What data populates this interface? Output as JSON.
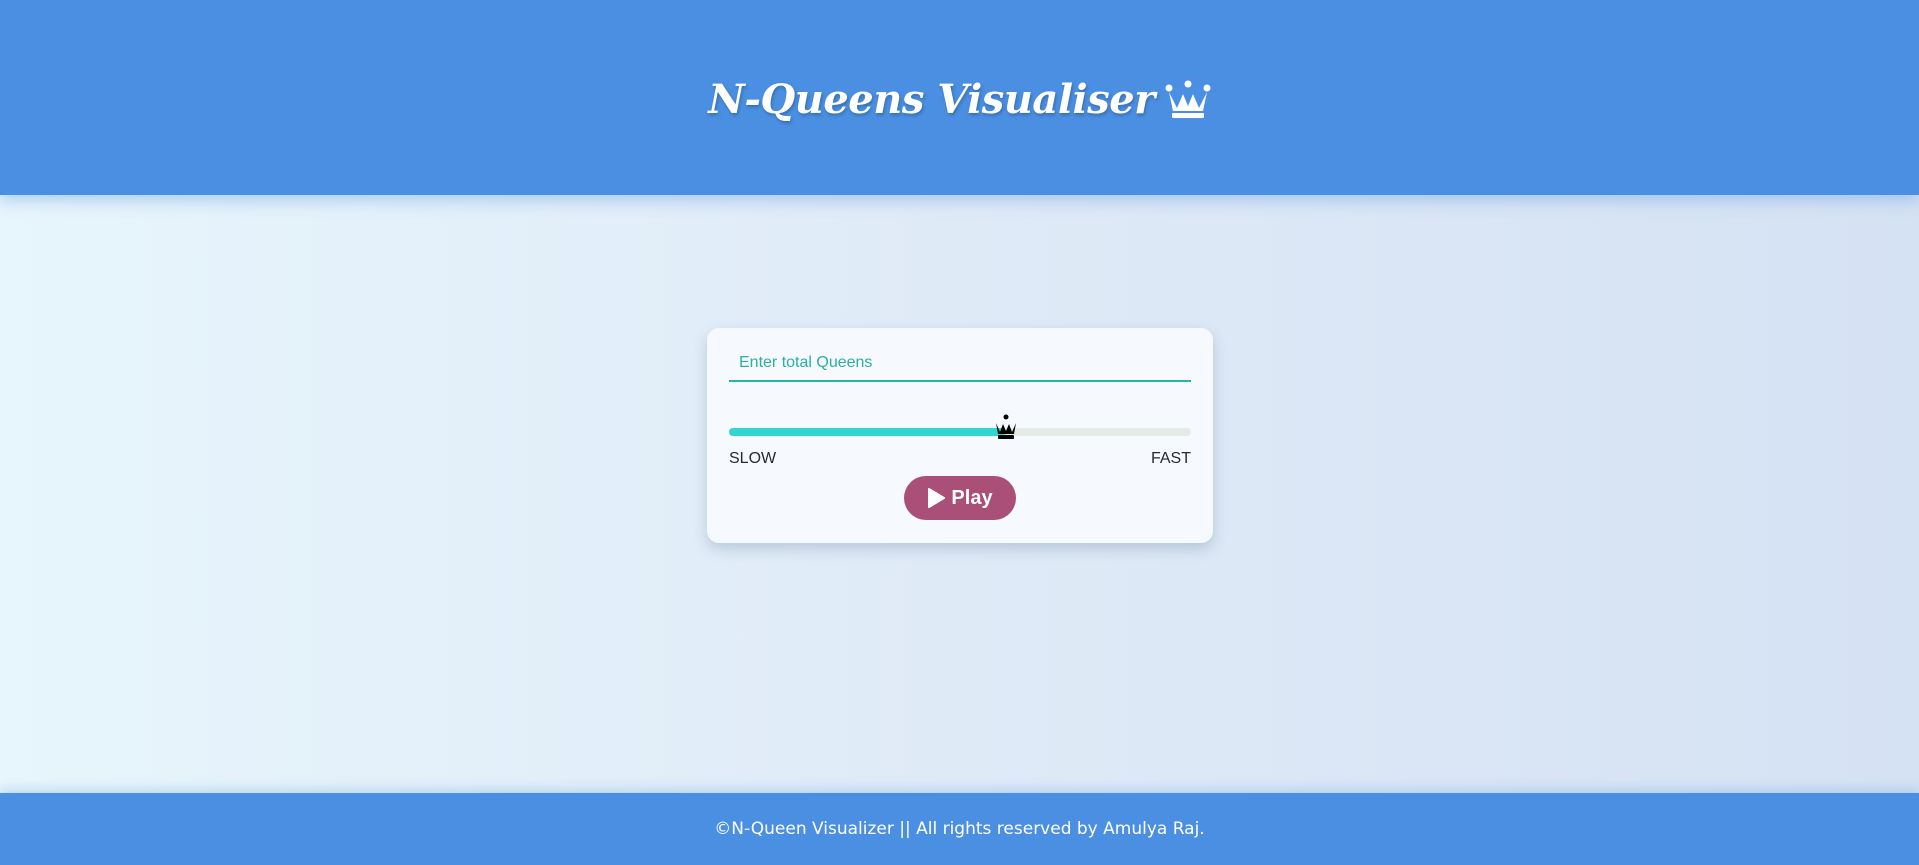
{
  "header": {
    "title": "N-Queens Visualiser",
    "icon": "crown-icon"
  },
  "controls": {
    "queens_input": {
      "placeholder": "Enter total Queens",
      "value": ""
    },
    "speed_slider": {
      "value_fraction": 0.6,
      "thumb_icon": "chess-queen-icon"
    },
    "slow_label": "SLOW",
    "fast_label": "FAST",
    "play_button": {
      "label": "Play",
      "icon": "play-icon"
    }
  },
  "footer": {
    "text": "©N-Queen Visualizer || All rights reserved by Amulya Raj."
  },
  "colors": {
    "header_bg": "#4a8fe2",
    "accent_teal": "#26b3a8",
    "slider_fill": "#34d4d0",
    "play_button": "#a94f78"
  }
}
